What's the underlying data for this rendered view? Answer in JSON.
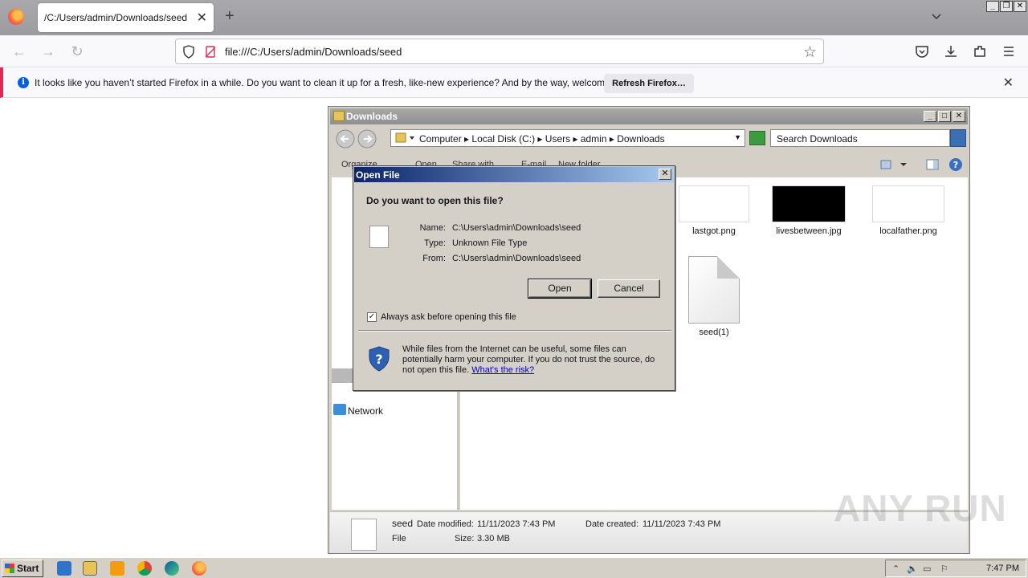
{
  "browser": {
    "tab_title": "/C:/Users/admin/Downloads/seed",
    "url": "file:///C:/Users/admin/Downloads/seed",
    "notification": {
      "message": "It looks like you haven’t started Firefox in a while. Do you want to clean it up for a fresh, like-new experience? And by the way, welcome back!",
      "button": "Refresh Firefox…"
    }
  },
  "explorer": {
    "title": "Downloads",
    "breadcrumb": [
      "Computer",
      "Local Disk (C:)",
      "Users",
      "admin",
      "Downloads"
    ],
    "search_placeholder": "Search Downloads",
    "toolbar": [
      "Organize",
      "Open",
      "Share with",
      "E-mail",
      "New folder"
    ],
    "nav_network": "Network",
    "files": [
      {
        "name": "lastgot.png"
      },
      {
        "name": "livesbetween.jpg"
      },
      {
        "name": "localfather.png"
      },
      {
        "name": "seed(1)"
      }
    ],
    "details": {
      "name": "seed",
      "type": "File",
      "modified_label": "Date modified:",
      "modified": "11/11/2023 7:43 PM",
      "created_label": "Date created:",
      "created": "11/11/2023 7:43 PM",
      "size_label": "Size:",
      "size": "3.30 MB"
    }
  },
  "dialog": {
    "title": "Open File",
    "question": "Do you want to open this file?",
    "name_label": "Name:",
    "name": "C:\\Users\\admin\\Downloads\\seed",
    "type_label": "Type:",
    "type": "Unknown File Type",
    "from_label": "From:",
    "from": "C:\\Users\\admin\\Downloads\\seed",
    "open_button": "Open",
    "cancel_button": "Cancel",
    "checkbox_label": "Always ask before opening this file",
    "checkbox_checked": true,
    "warning": "While files from the Internet can be useful, some files can potentially harm your computer. If you do not trust the source, do not open this file.",
    "risk_link": "What's the risk?"
  },
  "taskbar": {
    "start": "Start",
    "clock": "7:47 PM"
  },
  "watermark": "ANY RUN"
}
